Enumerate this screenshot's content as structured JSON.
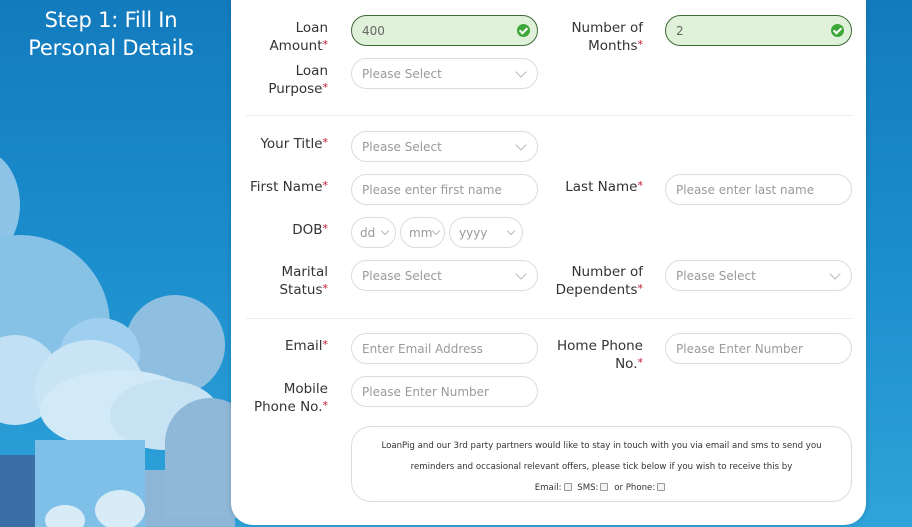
{
  "step_title": {
    "line1": "Step 1: Fill In",
    "line2": "Personal Details"
  },
  "colors": {
    "valid_bg": "#dff1d8",
    "valid_border": "#3d6b35",
    "check_green": "#3ea73a",
    "required_marker": "#c0152f",
    "background_blue": "#1a8ccc"
  },
  "required_marker": "*",
  "fields": {
    "loan_amount": {
      "label_1": "Loan",
      "label_2": "Amount",
      "value": "400",
      "status_icon": "check-circle-icon"
    },
    "number_of_months": {
      "label_1": "Number of",
      "label_2": "Months",
      "value": "2",
      "status_icon": "check-circle-icon"
    },
    "loan_purpose": {
      "label_1": "Loan",
      "label_2": "Purpose",
      "value": "Please Select"
    },
    "your_title": {
      "label": "Your Title",
      "value": "Please Select"
    },
    "first_name": {
      "label": "First Name",
      "placeholder": "Please enter first name"
    },
    "last_name": {
      "label": "Last Name",
      "placeholder": "Please enter last name"
    },
    "dob": {
      "label": "DOB",
      "day": "dd",
      "month": "mm",
      "year": "yyyy"
    },
    "marital_status": {
      "label_1": "Marital",
      "label_2": "Status",
      "value": "Please Select"
    },
    "number_of_dependents": {
      "label_1": "Number of",
      "label_2": "Dependents",
      "value": "Please Select"
    },
    "email": {
      "label": "Email",
      "placeholder": "Enter Email Address"
    },
    "home_phone": {
      "label_1": "Home Phone",
      "label_2": "No.",
      "placeholder": "Please Enter Number"
    },
    "mobile_phone": {
      "label_1": "Mobile",
      "label_2": "Phone No.",
      "placeholder": "Please Enter Number"
    }
  },
  "consent": {
    "line1": "LoanPig and our 3rd party partners would like to stay in touch with you via email and sms to send you",
    "line2": "reminders and occasional relevant offers, please tick below if you wish to receive this by",
    "email_label": "Email:",
    "sms_label": "SMS:",
    "phone_label": "or Phone:",
    "email_checked": false,
    "sms_checked": false,
    "phone_checked": false
  }
}
